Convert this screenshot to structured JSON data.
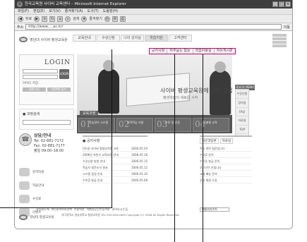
{
  "window": {
    "title": "한국교육원 사이버 교육센터 – Microsoft Internet Explorer"
  },
  "menu": [
    "파일(F)",
    "편집(E)",
    "보기(V)",
    "즐겨찾기(A)",
    "도구(T)",
    "도움말(H)"
  ],
  "toolbar": {
    "back": "뒤로",
    "search": "검색",
    "favorites": "즐겨찾기"
  },
  "address": {
    "label": "주소",
    "value": "http://www.....ac.kr/",
    "go": "이동"
  },
  "site": {
    "logo": "영남대 사이버 평생교육원",
    "nav": [
      "교육안내",
      "수강신청",
      "나의 강의실",
      "학습지원",
      "고객센터"
    ],
    "subnav": [
      "공지사항",
      "자주묻는 질문",
      "학습자료실",
      "자유게시판"
    ],
    "login": {
      "title": "LOGIN",
      "btn": "LOGIN",
      "save_id": "아이디 저장",
      "join": "회원가입",
      "find": "ID/PW 찾기"
    },
    "search": {
      "title": "● 과정검색"
    },
    "contact": {
      "head": "상담/안내",
      "tel1": "Tel. 02-881-7172",
      "tel2": "Fax. 02-881-7177",
      "hours": "평일 09:00–18:00"
    },
    "sidelinks": [
      "원격지원",
      "학습안내",
      "수강료",
      "이벤트"
    ],
    "banner": {
      "text": "사이버 평생교육원에 오신 것을 환영합니다",
      "sub": "평생학습의 새로운 시작",
      "bar_title": "교육과정",
      "right": "온라인 교육과정 안내"
    },
    "steps": [
      {
        "n": "01",
        "s": "학습관리 시스템"
      },
      {
        "n": "02",
        "s": "원격학습 지원"
      },
      {
        "n": "03",
        "s": "수료 및 인증"
      },
      {
        "n": "04",
        "s": "맞춤형 교육"
      }
    ],
    "quick": {
      "tab": "QUICK MENU",
      "items": [
        "수강신청",
        "강의실",
        "FAQ",
        "자료실",
        "TOP"
      ]
    },
    "news": {
      "title": "● 공지사항",
      "items": [
        {
          "t": "[안내] 사이버 평생교육원 오픈",
          "d": "2006.05.20"
        },
        {
          "t": "2006년 하반기 교육과정 안내",
          "d": "2006.05.18"
        },
        {
          "t": "수강신청 방법 안내",
          "d": "2006.05.15"
        },
        {
          "t": "학습자 설문조사 결과",
          "d": "2006.05.12"
        },
        {
          "t": "시스템 점검 안내",
          "d": "2006.05.10"
        },
        {
          "t": "수료증 발급 안내",
          "d": "2006.05.08"
        }
      ]
    },
    "qa": {
      "tabs": [
        "질문과답변",
        "자료실"
      ],
      "items": [
        "학습 관련 질문입니다",
        "수강료 문의",
        "수료증 발급 문의",
        "로그인이 안됩니다",
        "교재 배송 문의",
        "강의 재생 오류"
      ]
    },
    "footer": {
      "links": [
        "교육원소개",
        "개인정보보호정책",
        "이용약관",
        "이메일무단수집거부",
        "찾아오시는길"
      ],
      "logo": "영남대 평생교육원",
      "copyright": "대구광역시 영남대학교 평생교육원 TEL 053-000-0000 Copyright (C) 2006 All Rights Reserved.",
      "family_site": "패밀리사이트"
    }
  }
}
